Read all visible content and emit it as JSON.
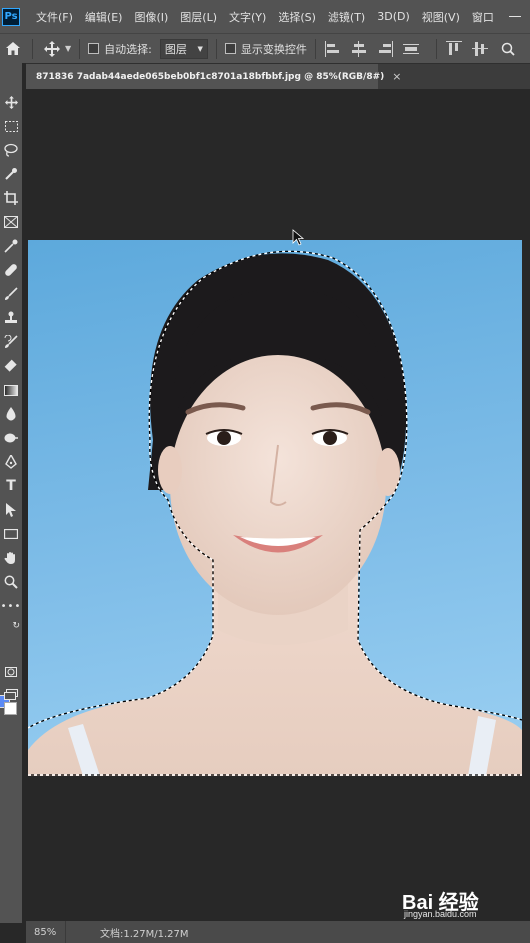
{
  "app": {
    "logo": "Ps"
  },
  "menu": {
    "items": [
      "文件(F)",
      "编辑(E)",
      "图像(I)",
      "图层(L)",
      "文字(Y)",
      "选择(S)",
      "滤镜(T)",
      "3D(D)",
      "视图(V)",
      "窗口"
    ]
  },
  "options_bar": {
    "auto_select_label": "自动选择:",
    "layer_select_value": "图层",
    "show_transform_label": "显示变换控件"
  },
  "document": {
    "tab_title": "871836 7adab44aede065beb0bf1c8701a18bfbbf.jpg @ 85%(RGB/8#)",
    "close_glyph": "×"
  },
  "status_bar": {
    "zoom": "85%",
    "doc_info": "文档:1.27M/1.27M"
  },
  "watermark": {
    "logo": "Bai 经验",
    "url": "jingyan.baidu.com"
  },
  "colors": {
    "foreground": "#5b8af5",
    "background": "#ffffff",
    "panel": "#535353",
    "canvas_bg": "#282828"
  },
  "icons": {
    "tools": [
      "move-icon",
      "marquee-icon",
      "lasso-icon",
      "quick-select-icon",
      "crop-icon",
      "frame-icon",
      "eyedropper-icon",
      "healing-brush-icon",
      "brush-icon",
      "clone-stamp-icon",
      "history-brush-icon",
      "eraser-icon",
      "gradient-icon",
      "blur-icon",
      "dodge-icon",
      "pen-icon",
      "type-icon",
      "path-select-icon",
      "rectangle-icon",
      "hand-icon",
      "zoom-icon",
      "more-tools-icon"
    ]
  }
}
